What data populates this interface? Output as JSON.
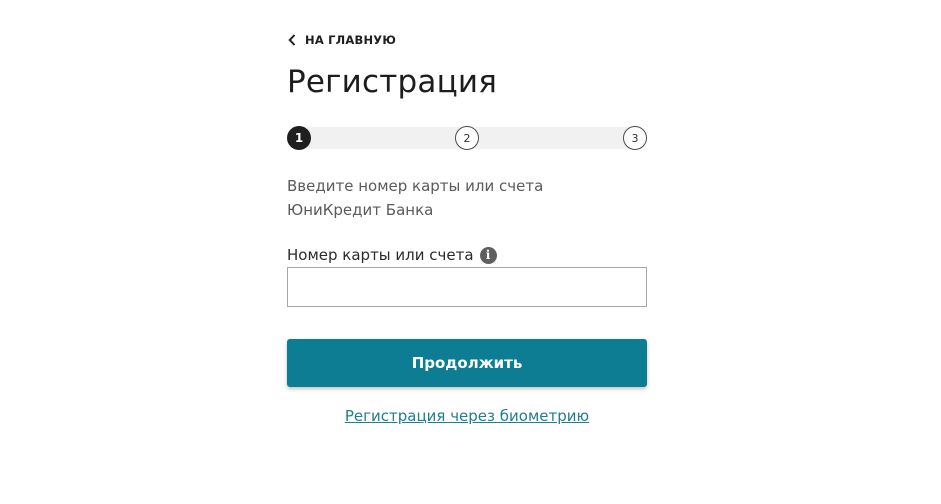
{
  "nav": {
    "back_label": "НА ГЛАВНУЮ",
    "back_icon": "chevron-left-icon"
  },
  "page": {
    "title": "Регистрация"
  },
  "stepper": {
    "current": 1,
    "steps": [
      "1",
      "2",
      "3"
    ]
  },
  "form": {
    "description_line1": "Введите номер карты или счета",
    "description_line2": "ЮниКредит Банка",
    "field_label": "Номер карты или счета",
    "field_value": "",
    "info_icon": "info-icon",
    "submit_label": "Продолжить",
    "biometry_link": "Регистрация через биометрию"
  },
  "colors": {
    "accent": "#0d7d93",
    "link": "#1f7d94",
    "step_active": "#1f1f1f",
    "track": "#f1f1f1"
  }
}
